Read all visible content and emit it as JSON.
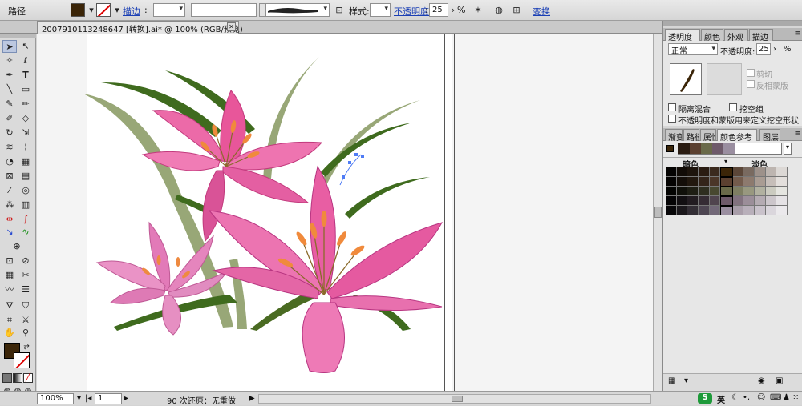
{
  "control_bar": {
    "mode_label": "路径",
    "fill_color": "#3b2508",
    "stroke_label": "描边",
    "style_label": "样式",
    "opacity_label": "不透明度",
    "opacity_value": "25",
    "percent": "%",
    "transform_label": "变换"
  },
  "document_tab": {
    "title": "20079101132486​47 [转换].ai* @ 100% (RGB/预览)"
  },
  "status": {
    "zoom": "100%",
    "artboard": "1",
    "undo_text": "90 次还原：无重做"
  },
  "panels": {
    "transparency_tabs": [
      "透明度",
      "颜色",
      "外观",
      "描边"
    ],
    "blend_mode": "正常",
    "opacity_label": "不透明度",
    "opacity_value": "25",
    "clip_label": "剪切",
    "invert_mask_label": "反相蒙版",
    "isolate_blend_label": "隔离混合",
    "knockout_group_label": "挖空组",
    "opacity_mask_label": "不透明度和蒙版用来定义挖空形状",
    "guide_tabs": [
      "渐变",
      "路径",
      "属性",
      "颜色参考",
      "图层"
    ],
    "shades_label": "暗色",
    "tints_label": "淡色",
    "harmony_colors": [
      "#2a1c12",
      "#5b4030",
      "#6a6a4a",
      "#6e5a6a",
      "#9a8ea0"
    ]
  },
  "colors": {
    "accent_link": "#1a3fb5",
    "petal_pink": "#e8569a",
    "leaf_green": "#3f6b1e",
    "leaf_sage": "#8fa06a"
  }
}
